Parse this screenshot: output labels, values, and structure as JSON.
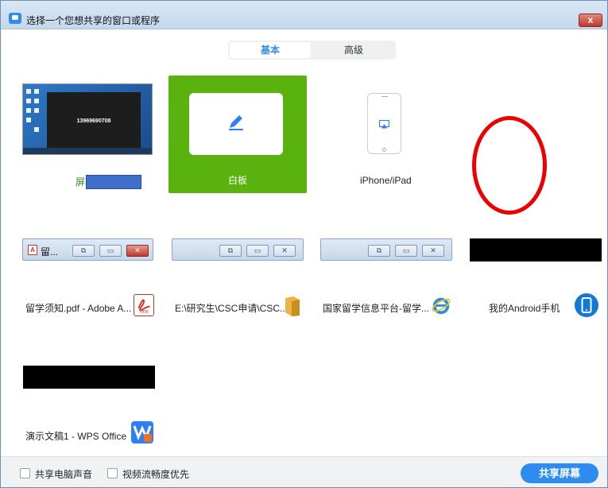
{
  "window": {
    "title": "选择一个您想共享的窗口或程序",
    "close_label": "x"
  },
  "tabs": [
    {
      "label": "基本",
      "active": true
    },
    {
      "label": "高级",
      "active": false
    }
  ],
  "tiles": {
    "screen": {
      "label": "屏幕",
      "preview_number": "13969690708"
    },
    "whiteboard": {
      "label": "白板"
    },
    "iphone": {
      "label": "iPhone/iPad"
    }
  },
  "windows": [
    {
      "title_bar_text": "留...",
      "label": "留学须知.pdf - Adobe A...",
      "icon": "adobe-pdf-icon",
      "icon_text": "PDF"
    },
    {
      "title_bar_text": "",
      "label": "E:\\研究生\\CSC申请\\CSC...",
      "icon": "folder-icon"
    },
    {
      "title_bar_text": "",
      "label": "国家留学信息平台-留学...",
      "icon": "internet-explorer-icon"
    },
    {
      "title_bar_text": "",
      "label": "我的Android手机",
      "icon": "android-phone-icon"
    },
    {
      "title_bar_text": "",
      "label": "演示文稿1 - WPS Office",
      "icon": "wps-icon"
    }
  ],
  "bottom": {
    "share_audio_label": "共享电脑声音",
    "video_priority_label": "视频流畅度优先",
    "share_button_label": "共享屏幕"
  },
  "colors": {
    "accent": "#2d8cf0",
    "whiteboard_green": "#5ab20f",
    "annotation_red": "#ee0000"
  }
}
